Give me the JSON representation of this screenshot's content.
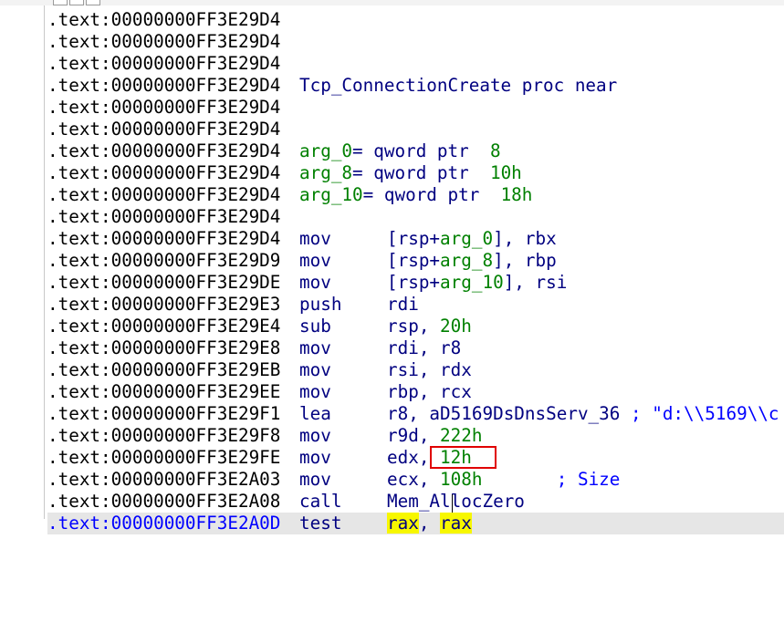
{
  "prefix": ".text:",
  "lines": [
    {
      "addr": "00000000FF3E29D4"
    },
    {
      "addr": "00000000FF3E29D4"
    },
    {
      "addr": "00000000FF3E29D4"
    },
    {
      "addr": "00000000FF3E29D4",
      "proc_name": "Tcp_ConnectionCreate",
      "proc_kw": "proc near"
    },
    {
      "addr": "00000000FF3E29D4"
    },
    {
      "addr": "00000000FF3E29D4"
    },
    {
      "addr": "00000000FF3E29D4",
      "var": "arg_0",
      "def": "= qword ptr  ",
      "val": "8"
    },
    {
      "addr": "00000000FF3E29D4",
      "var": "arg_8",
      "def": "= qword ptr  ",
      "val": "10h"
    },
    {
      "addr": "00000000FF3E29D4",
      "var": "arg_10",
      "def": "= qword ptr  ",
      "val": "18h"
    },
    {
      "addr": "00000000FF3E29D4"
    },
    {
      "addr": "00000000FF3E29D4",
      "mnem": "mov",
      "ops_a": "[rsp+",
      "ops_var": "arg_0",
      "ops_b": "], rbx"
    },
    {
      "addr": "00000000FF3E29D9",
      "mnem": "mov",
      "ops_a": "[rsp+",
      "ops_var": "arg_8",
      "ops_b": "], rbp"
    },
    {
      "addr": "00000000FF3E29DE",
      "mnem": "mov",
      "ops_a": "[rsp+",
      "ops_var": "arg_10",
      "ops_b": "], rsi"
    },
    {
      "addr": "00000000FF3E29E3",
      "mnem": "push",
      "ops_a": "rdi"
    },
    {
      "addr": "00000000FF3E29E4",
      "mnem": "sub",
      "ops_a": "rsp, ",
      "ops_num": "20h"
    },
    {
      "addr": "00000000FF3E29E8",
      "mnem": "mov",
      "ops_a": "rdi, r8"
    },
    {
      "addr": "00000000FF3E29EB",
      "mnem": "mov",
      "ops_a": "rsi, rdx"
    },
    {
      "addr": "00000000FF3E29EE",
      "mnem": "mov",
      "ops_a": "rbp, rcx"
    },
    {
      "addr": "00000000FF3E29F1",
      "mnem": "lea",
      "ops_a": "r8, aD5169DsDnsServ_36",
      "cmt": " ; \"d:\\\\5169\\\\c"
    },
    {
      "addr": "00000000FF3E29F8",
      "mnem": "mov",
      "ops_a": "r9d, ",
      "ops_num": "222h"
    },
    {
      "addr": "00000000FF3E29FE",
      "mnem": "mov",
      "ops_a": "edx, ",
      "ops_num": "12h"
    },
    {
      "addr": "00000000FF3E2A03",
      "mnem": "mov",
      "ops_a": "ecx, ",
      "ops_num": "108h",
      "cmt": "       ; Size"
    },
    {
      "addr": "00000000FF3E2A08",
      "mnem": "call",
      "ops_a": "Mem_AllocZero"
    },
    {
      "addr": "00000000FF3E2A0D",
      "mnem": "test",
      "ops_hl1": "rax",
      "ops_sep": ", ",
      "ops_hl2": "rax"
    }
  ],
  "colors": {
    "address": "#000000",
    "current_address": "#0000ff",
    "instruction": "#000080",
    "variable": "#008000",
    "number": "#008000",
    "comment": "#0000ff",
    "highlight": "#f7f700",
    "current_line_bg": "#e6e6e6",
    "annotation_box": "#e00000"
  }
}
